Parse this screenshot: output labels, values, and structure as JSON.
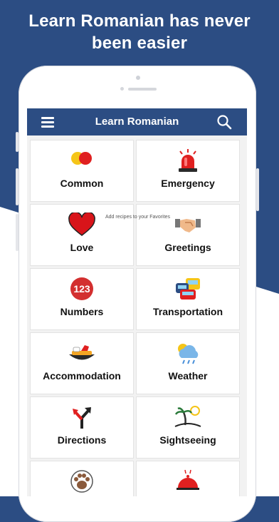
{
  "headline": {
    "line1": "Learn Romanian has never",
    "line2": "been easier"
  },
  "appbar": {
    "title": "Learn Romanian",
    "menu_icon": "hamburger-icon",
    "search_icon": "search-icon"
  },
  "categories": [
    {
      "label": "Common",
      "icon": "common-dots-icon"
    },
    {
      "label": "Emergency",
      "icon": "siren-icon"
    },
    {
      "label": "Love",
      "icon": "heart-icon"
    },
    {
      "label": "Greetings",
      "icon": "handshake-icon"
    },
    {
      "label": "Numbers",
      "icon": "numbers-123-icon"
    },
    {
      "label": "Transportation",
      "icon": "traffic-cars-icon"
    },
    {
      "label": "Accommodation",
      "icon": "bed-icon"
    },
    {
      "label": "Weather",
      "icon": "cloud-sun-rain-icon"
    },
    {
      "label": "Directions",
      "icon": "directions-arrows-icon"
    },
    {
      "label": "Sightseeing",
      "icon": "island-icon"
    },
    {
      "label": "",
      "icon": "paw-icon"
    },
    {
      "label": "",
      "icon": "food-cloche-icon"
    }
  ],
  "toast": "Add recipes to your Favorites",
  "colors": {
    "brand": "#2c4d83",
    "red": "#e02020",
    "yellow": "#f5c518"
  }
}
